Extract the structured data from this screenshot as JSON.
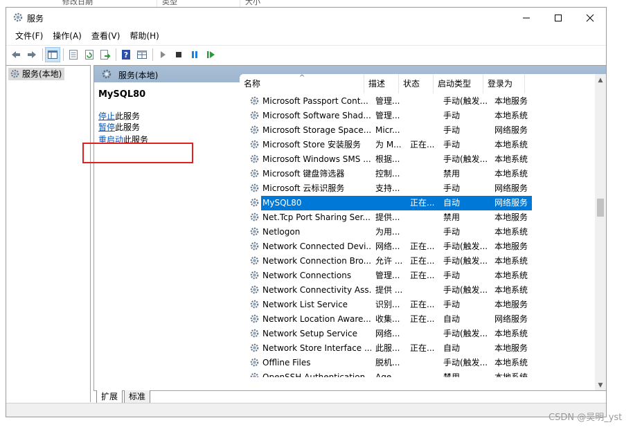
{
  "background_header": {
    "col1": "修改日期",
    "col2": "类型",
    "col3": "大小"
  },
  "window": {
    "title": "服务",
    "icon": "gear-icon"
  },
  "menu": [
    {
      "label": "文件(F)"
    },
    {
      "label": "操作(A)"
    },
    {
      "label": "查看(V)"
    },
    {
      "label": "帮助(H)"
    }
  ],
  "toolbar": {
    "icons": [
      "back-arrow-icon",
      "forward-arrow-icon",
      "show-hide-console-tree-icon",
      "properties-icon",
      "refresh-icon",
      "export-list-icon",
      "help-icon",
      "console-view-icon",
      "start-service-icon",
      "stop-service-icon",
      "pause-service-icon",
      "restart-service-icon"
    ]
  },
  "tree": {
    "item_label": "服务(本地)"
  },
  "main": {
    "header_title": "服务(本地)",
    "selected_service": "MySQL80",
    "actions": {
      "stop_link": "停止",
      "stop_suffix": "此服务",
      "pause_link": "暂停",
      "pause_suffix": "此服务",
      "restart_link": "重启动",
      "restart_suffix": "此服务"
    }
  },
  "table": {
    "columns": [
      "名称",
      "描述",
      "状态",
      "启动类型",
      "登录为"
    ],
    "rows": [
      {
        "name": "Microsoft Passport Cont...",
        "desc": "管理...",
        "status": "",
        "startup": "手动(触发...",
        "logon": "本地服务"
      },
      {
        "name": "Microsoft Software Shad...",
        "desc": "管理...",
        "status": "",
        "startup": "手动",
        "logon": "本地系统"
      },
      {
        "name": "Microsoft Storage Space...",
        "desc": "Micr...",
        "status": "",
        "startup": "手动",
        "logon": "网络服务"
      },
      {
        "name": "Microsoft Store 安装服务",
        "desc": "为 M...",
        "status": "正在...",
        "startup": "手动",
        "logon": "本地系统"
      },
      {
        "name": "Microsoft Windows SMS ...",
        "desc": "根据...",
        "status": "",
        "startup": "手动(触发...",
        "logon": "本地系统"
      },
      {
        "name": "Microsoft 键盘筛选器",
        "desc": "控制...",
        "status": "",
        "startup": "禁用",
        "logon": "本地系统"
      },
      {
        "name": "Microsoft 云标识服务",
        "desc": "支持...",
        "status": "",
        "startup": "手动",
        "logon": "网络服务"
      },
      {
        "name": "MySQL80",
        "desc": "",
        "status": "正在...",
        "startup": "自动",
        "logon": "网络服务",
        "selected": true
      },
      {
        "name": "Net.Tcp Port Sharing Ser...",
        "desc": "提供...",
        "status": "",
        "startup": "禁用",
        "logon": "本地服务"
      },
      {
        "name": "Netlogon",
        "desc": "为用...",
        "status": "",
        "startup": "手动",
        "logon": "本地系统"
      },
      {
        "name": "Network Connected Devi...",
        "desc": "网络...",
        "status": "正在...",
        "startup": "手动(触发...",
        "logon": "本地服务"
      },
      {
        "name": "Network Connection Bro...",
        "desc": "允许 ...",
        "status": "正在...",
        "startup": "手动(触发...",
        "logon": "本地系统"
      },
      {
        "name": "Network Connections",
        "desc": "管理...",
        "status": "正在...",
        "startup": "手动",
        "logon": "本地系统"
      },
      {
        "name": "Network Connectivity Ass...",
        "desc": "提供 ...",
        "status": "",
        "startup": "手动(触发...",
        "logon": "本地系统"
      },
      {
        "name": "Network List Service",
        "desc": "识别...",
        "status": "正在...",
        "startup": "手动",
        "logon": "本地服务"
      },
      {
        "name": "Network Location Aware...",
        "desc": "收集...",
        "status": "正在...",
        "startup": "自动",
        "logon": "网络服务"
      },
      {
        "name": "Network Setup Service",
        "desc": "网络...",
        "status": "",
        "startup": "手动(触发...",
        "logon": "本地系统"
      },
      {
        "name": "Network Store Interface ...",
        "desc": "此服...",
        "status": "正在...",
        "startup": "自动",
        "logon": "本地服务"
      },
      {
        "name": "Offline Files",
        "desc": "脱机...",
        "status": "",
        "startup": "手动(触发...",
        "logon": "本地系统"
      },
      {
        "name": "OpenSSH Authentication ...",
        "desc": "Age...",
        "status": "",
        "startup": "禁用",
        "logon": "本地系统",
        "partial": true
      }
    ]
  },
  "tabs": [
    {
      "label": "扩展",
      "active": true
    },
    {
      "label": "标准",
      "active": false
    }
  ],
  "watermark": "CSDN @吴明_yst",
  "colors": {
    "selection": "#0078d7",
    "link": "#0a55b8",
    "highlight_box": "#e02020",
    "header_band": "#a8bfd6"
  }
}
